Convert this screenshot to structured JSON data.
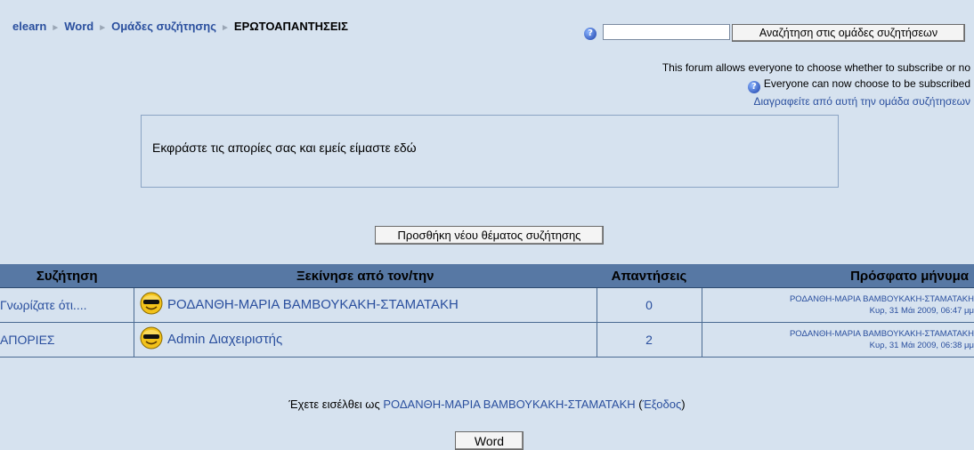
{
  "breadcrumb": {
    "items": [
      "elearn",
      "Word",
      "Ομάδες συζήτησης"
    ],
    "current": "ΕΡΩΤΟΑΠΑΝΤΗΣΕΙΣ",
    "separator": "►"
  },
  "search": {
    "value": "",
    "button_label": "Αναζήτηση στις ομάδες συζητήσεων"
  },
  "subscription": {
    "info": "This forum allows everyone to choose whether to subscribe or no",
    "status": "Everyone can now choose to be subscribed",
    "unsubscribe_link": "Διαγραφείτε από αυτή την ομάδα συζήτησεων"
  },
  "intro": "Εκφράστε τις απορίες σας και εμείς είμαστε εδώ",
  "add_topic_label": "Προσθήκη νέου θέματος συζήτησης",
  "table": {
    "headers": [
      "Συζήτηση",
      "Ξεκίνησε από τον/την",
      "Απαντήσεις",
      "Πρόσφατο μήνυμα"
    ],
    "rows": [
      {
        "topic": "Γνωρίζατε ότι....",
        "author": "ΡΟΔΑΝΘΗ-ΜΑΡΙΑ ΒΑΜΒΟΥΚΑΚΗ-ΣΤΑΜΑΤΑΚΗ",
        "replies": "0",
        "last_author": "ΡΟΔΑΝΘΗ-ΜΑΡΙΑ ΒΑΜΒΟΥΚΑΚΗ-ΣΤΑΜΑΤΑΚΗ",
        "last_date": "Κυρ, 31 Μάι 2009, 06:47 μμ"
      },
      {
        "topic": "ΑΠΟΡΙΕΣ",
        "author": "Admin Διαχειριστής",
        "replies": "2",
        "last_author": "ΡΟΔΑΝΘΗ-ΜΑΡΙΑ ΒΑΜΒΟΥΚΑΚΗ-ΣΤΑΜΑΤΑΚΗ",
        "last_date": "Κυρ, 31 Μάι 2009, 06:38 μμ"
      }
    ]
  },
  "login": {
    "prefix": "Έχετε εισέλθει ως ",
    "user": "ΡΟΔΑΝΘΗ-ΜΑΡΙΑ ΒΑΜΒΟΥΚΑΚΗ-ΣΤΑΜΑΤΑΚΗ",
    "open_paren": " (",
    "logout": "Έξοδος",
    "close_paren": ")"
  },
  "home_button": "Word",
  "icons": {
    "help": "help-icon",
    "avatar": "sunglasses-smiley-icon"
  },
  "colors": {
    "background": "#d6e2ef",
    "header": "#5778a4",
    "link": "#2a4f9e"
  }
}
